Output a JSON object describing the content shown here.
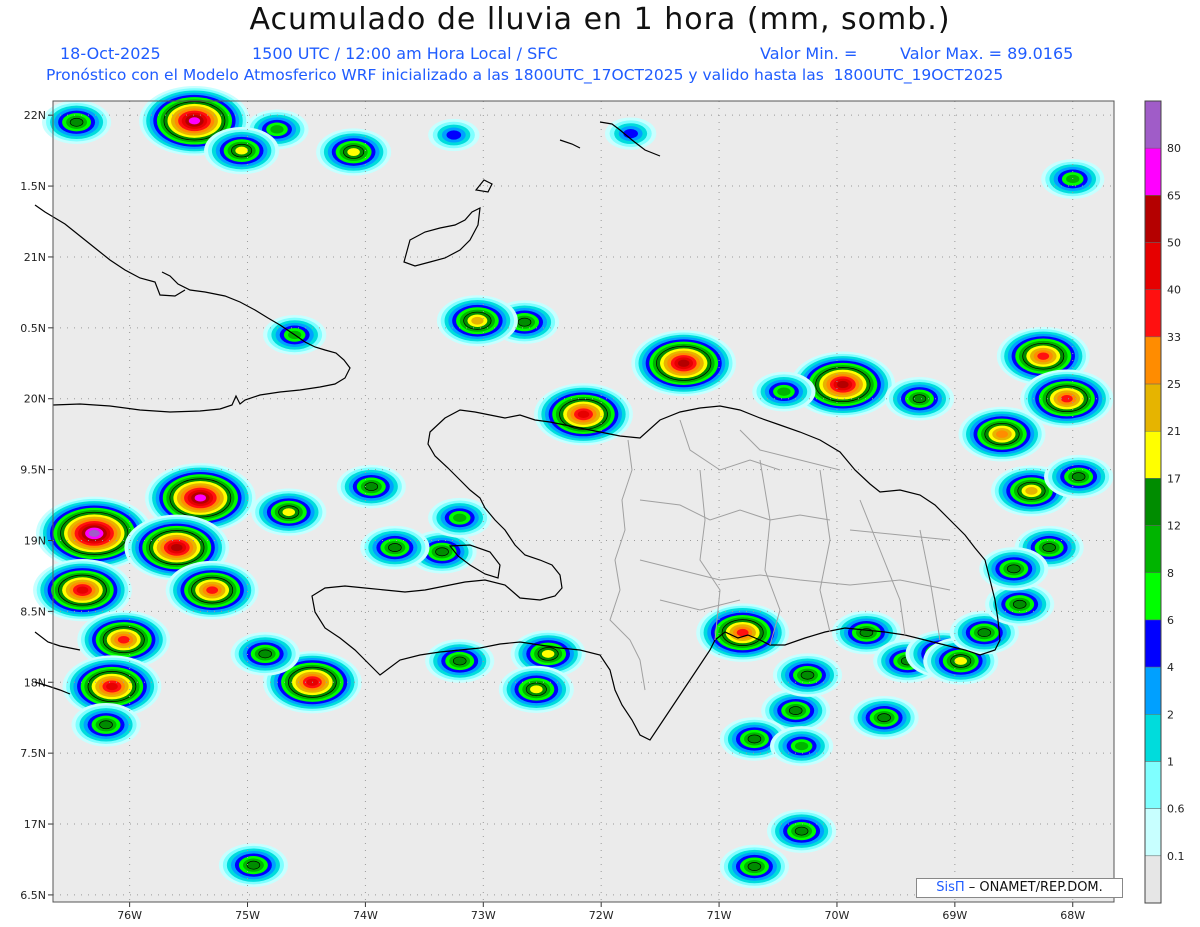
{
  "header": {
    "title": "Acumulado de lluvia en 1 hora (mm, somb.)",
    "date": "18-Oct-2025",
    "time": "1500 UTC / 12:00 am Hora Local / SFC",
    "val_min": "Valor Min. =",
    "val_max": "Valor Max. = 89.0165",
    "model_line": "Pronóstico con el Modelo Atmosferico WRF inicializado a las 1800UTC_17OCT2025 y valido hasta las  1800UTC_19OCT2025"
  },
  "map": {
    "lon_ticks": [
      "76W",
      "75W",
      "74W",
      "73W",
      "72W",
      "71W",
      "70W",
      "69W",
      "68W"
    ],
    "lat_ticks": [
      "22N",
      "1.5N",
      "21N",
      "0.5N",
      "20N",
      "9.5N",
      "19N",
      "8.5N",
      "18N",
      "7.5N",
      "17N",
      "6.5N"
    ],
    "lon_range": [
      -76.65,
      -67.65
    ],
    "lat_range": [
      16.45,
      22.1
    ]
  },
  "legend": {
    "labels": [
      "80",
      "65",
      "50",
      "40",
      "33",
      "25",
      "21",
      "17",
      "12",
      "8",
      "6",
      "4",
      "2",
      "1",
      "0.6",
      "0.1"
    ],
    "colors": [
      "#a05cc8",
      "#ff00ff",
      "#b40000",
      "#e60000",
      "#ff1010",
      "#ff8c00",
      "#e6b400",
      "#ffff00",
      "#008c00",
      "#00b400",
      "#00ff00",
      "#0000ff",
      "#00a0ff",
      "#00dcdc",
      "#7fffff",
      "#c8ffff",
      "#e6e6e6"
    ]
  },
  "credit": {
    "brand": "SisΠ",
    "text": "– ONAMET/REP.DOM."
  },
  "colors": {
    "background_map": "#ebebeb",
    "coast": "#000000",
    "provinces": "#a0a0a0",
    "header_blue": "#1f5cff"
  },
  "chart_data": {
    "type": "heatmap",
    "variable": "Acumulado de lluvia en 1 hora (mm)",
    "max_value": 89.0165,
    "cells": [
      {
        "lon": -75.45,
        "lat": 21.96,
        "v": 65
      },
      {
        "lon": -76.45,
        "lat": 21.95,
        "v": 12
      },
      {
        "lon": -74.75,
        "lat": 21.9,
        "v": 8
      },
      {
        "lon": -75.05,
        "lat": 21.75,
        "v": 17
      },
      {
        "lon": -74.1,
        "lat": 21.74,
        "v": 17
      },
      {
        "lon": -73.25,
        "lat": 21.86,
        "v": 4
      },
      {
        "lon": -71.75,
        "lat": 21.87,
        "v": 4
      },
      {
        "lon": -71.3,
        "lat": 20.25,
        "v": 50
      },
      {
        "lon": -69.95,
        "lat": 20.1,
        "v": 50
      },
      {
        "lon": -72.15,
        "lat": 19.89,
        "v": 40
      },
      {
        "lon": -72.65,
        "lat": 20.54,
        "v": 12
      },
      {
        "lon": -73.05,
        "lat": 20.55,
        "v": 21
      },
      {
        "lon": -74.6,
        "lat": 20.45,
        "v": 8
      },
      {
        "lon": -69.3,
        "lat": 20.0,
        "v": 12
      },
      {
        "lon": -70.45,
        "lat": 20.05,
        "v": 8
      },
      {
        "lon": -68.25,
        "lat": 20.3,
        "v": 33
      },
      {
        "lon": -68.05,
        "lat": 20.0,
        "v": 33
      },
      {
        "lon": -68.6,
        "lat": 19.75,
        "v": 25
      },
      {
        "lon": -68.35,
        "lat": 19.35,
        "v": 21
      },
      {
        "lon": -67.95,
        "lat": 19.45,
        "v": 12
      },
      {
        "lon": -68.2,
        "lat": 18.95,
        "v": 12
      },
      {
        "lon": -76.3,
        "lat": 19.05,
        "v": 80
      },
      {
        "lon": -75.4,
        "lat": 19.3,
        "v": 65
      },
      {
        "lon": -75.6,
        "lat": 18.95,
        "v": 50
      },
      {
        "lon": -76.4,
        "lat": 18.65,
        "v": 40
      },
      {
        "lon": -75.3,
        "lat": 18.65,
        "v": 33
      },
      {
        "lon": -74.65,
        "lat": 19.2,
        "v": 17
      },
      {
        "lon": -73.95,
        "lat": 19.38,
        "v": 12
      },
      {
        "lon": -76.05,
        "lat": 18.3,
        "v": 33
      },
      {
        "lon": -76.15,
        "lat": 17.97,
        "v": 40
      },
      {
        "lon": -74.45,
        "lat": 18.0,
        "v": 40
      },
      {
        "lon": -74.85,
        "lat": 18.2,
        "v": 12
      },
      {
        "lon": -73.35,
        "lat": 18.92,
        "v": 12
      },
      {
        "lon": -73.2,
        "lat": 19.16,
        "v": 8
      },
      {
        "lon": -73.75,
        "lat": 18.95,
        "v": 12
      },
      {
        "lon": -72.45,
        "lat": 18.2,
        "v": 17
      },
      {
        "lon": -73.2,
        "lat": 18.15,
        "v": 12
      },
      {
        "lon": -72.55,
        "lat": 17.95,
        "v": 17
      },
      {
        "lon": -70.8,
        "lat": 18.35,
        "v": 33
      },
      {
        "lon": -70.35,
        "lat": 17.8,
        "v": 12
      },
      {
        "lon": -70.25,
        "lat": 18.05,
        "v": 12
      },
      {
        "lon": -69.75,
        "lat": 18.35,
        "v": 12
      },
      {
        "lon": -69.4,
        "lat": 18.15,
        "v": 12
      },
      {
        "lon": -69.1,
        "lat": 18.2,
        "v": 17
      },
      {
        "lon": -68.95,
        "lat": 18.15,
        "v": 17
      },
      {
        "lon": -68.75,
        "lat": 18.35,
        "v": 12
      },
      {
        "lon": -68.45,
        "lat": 18.55,
        "v": 12
      },
      {
        "lon": -68.5,
        "lat": 18.8,
        "v": 12
      },
      {
        "lon": -70.7,
        "lat": 17.6,
        "v": 12
      },
      {
        "lon": -70.3,
        "lat": 17.55,
        "v": 8
      },
      {
        "lon": -69.6,
        "lat": 17.75,
        "v": 12
      },
      {
        "lon": -70.3,
        "lat": 16.95,
        "v": 12
      },
      {
        "lon": -70.7,
        "lat": 16.7,
        "v": 12
      },
      {
        "lon": -74.95,
        "lat": 16.71,
        "v": 12
      },
      {
        "lon": -76.2,
        "lat": 17.7,
        "v": 12
      },
      {
        "lon": -68.0,
        "lat": 21.55,
        "v": 8
      }
    ]
  }
}
